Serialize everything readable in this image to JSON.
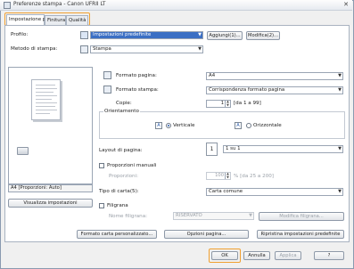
{
  "window": {
    "title": "Preferenze stampa - Canon UFRII LT",
    "close_glyph": "✕"
  },
  "tabs": [
    {
      "label": "Impostazione pagina"
    },
    {
      "label": "Finitura"
    },
    {
      "label": "Qualità"
    }
  ],
  "top": {
    "profile_label": "Profilo:",
    "profile_value": "Impostazioni predefinite",
    "add_label": "Aggiungi(1)...",
    "modify_label": "Modifica(2)...",
    "output_method_label": "Metodo di stampa:",
    "output_method_value": "Stampa"
  },
  "preview": {
    "caption": "A4 [Proporzioni: Auto]",
    "view_settings_label": "Visualizza impostazioni"
  },
  "page_settings": {
    "page_size_label": "Formato pagina:",
    "page_size_value": "A4",
    "output_size_label": "Formato stampa:",
    "output_size_value": "Corrispondenza formato pagina",
    "copies_label": "Copie:",
    "copies_value": "1",
    "copies_range": "[da 1 a 99]",
    "orientation_label": "Orientamento",
    "orientation_portrait_label": "Verticale",
    "orientation_landscape_label": "Orizzontale",
    "orientation_selected": "Verticale",
    "page_layout_label": "Layout di pagina:",
    "page_layout_value": "1 su 1",
    "manual_scaling_label": "Proporzioni manuali",
    "scaling_label": "Proporzioni:",
    "scaling_value": "100",
    "scaling_range": "% [da 25 a 200]",
    "paper_type_label": "Tipo di carta(5):",
    "paper_type_value": "Carta comune",
    "watermark_label": "Filigrana",
    "watermark_name_label": "Nome filigrana:",
    "watermark_name_value": "RISERVATO",
    "edit_watermark_label": "Modifica filigrana..."
  },
  "bottom": {
    "custom_paper_label": "Formato carta personalizzato...",
    "page_options_label": "Opzioni pagina...",
    "restore_defaults_label": "Ripristina impostazioni predefinite"
  },
  "dialog_buttons": {
    "ok_label": "OK",
    "cancel_label": "Annulla",
    "apply_label": "Applica",
    "help_label": "?"
  },
  "colors": {
    "accent_highlight": "#f0a030",
    "selection": "#3b6fc4"
  }
}
